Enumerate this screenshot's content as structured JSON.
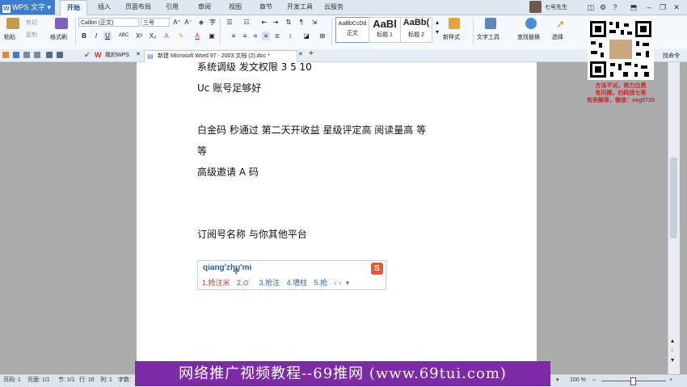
{
  "app": {
    "title": "WPS 文字"
  },
  "menu_tabs": [
    "开始",
    "插入",
    "页面布局",
    "引用",
    "审阅",
    "视图",
    "章节",
    "开发工具",
    "云服务"
  ],
  "user": {
    "name": "七号先生"
  },
  "ribbon": {
    "paste": "粘贴",
    "cut": "剪切",
    "copy": "复制",
    "format_painter": "格式刷",
    "font_name": "Calibri (正文)",
    "font_size": "三号",
    "bold": "B",
    "italic": "I",
    "underline": "U",
    "strike": "ABC",
    "superscript": "X²",
    "subscript": "X₂",
    "styles": [
      {
        "preview": "AaBbCcDd",
        "name": "正文"
      },
      {
        "preview": "AaBl",
        "name": "标题 1"
      },
      {
        "preview": "AaBb(",
        "name": "标题 2"
      }
    ],
    "new_style": "新样式",
    "text_tools": "文字工具",
    "find_replace": "查找替换",
    "select": "选择"
  },
  "tabs_bar": {
    "my_wps": "我的WPS",
    "doc_tab": "新建 Microsoft Word 97 - 2003 文档 (2).doc *",
    "add": "+",
    "help_link": "找命令"
  },
  "document": {
    "lines": [
      "系统调级    发文权限   3     5    10",
      "Uc 账号足够好",
      "白金码    秒通过  第二天开收益  星级评定高  阅读量高   等",
      "等",
      "高级邀请  A 码",
      "订阅号名称      与你其他平台"
    ]
  },
  "ime": {
    "input": "qiang'zhu'mi",
    "candidates": [
      "1.抢注米",
      "2.⊙",
      "3.抢注",
      "4.墙柱",
      "5.抢"
    ],
    "logo": "S"
  },
  "status_bar": {
    "page": "页码: 1",
    "pages": "页面: 1/1",
    "section": "节: 1/1",
    "row": "行: 16",
    "col": "列: 1",
    "words": "字数:",
    "zoom": "100 %"
  },
  "promo": {
    "notes": [
      "方法不对，努力白费",
      "有问题，扫码找七哥",
      "有些解答，微信：sog0720"
    ],
    "banner": "网络推广视频教程--69推网 (www.69tui.com)"
  },
  "colors": {
    "accent": "#3d7dcf",
    "banner": "#7c2aa6",
    "promo_red": "#d32020",
    "ime_blue": "#2a5fb0"
  }
}
